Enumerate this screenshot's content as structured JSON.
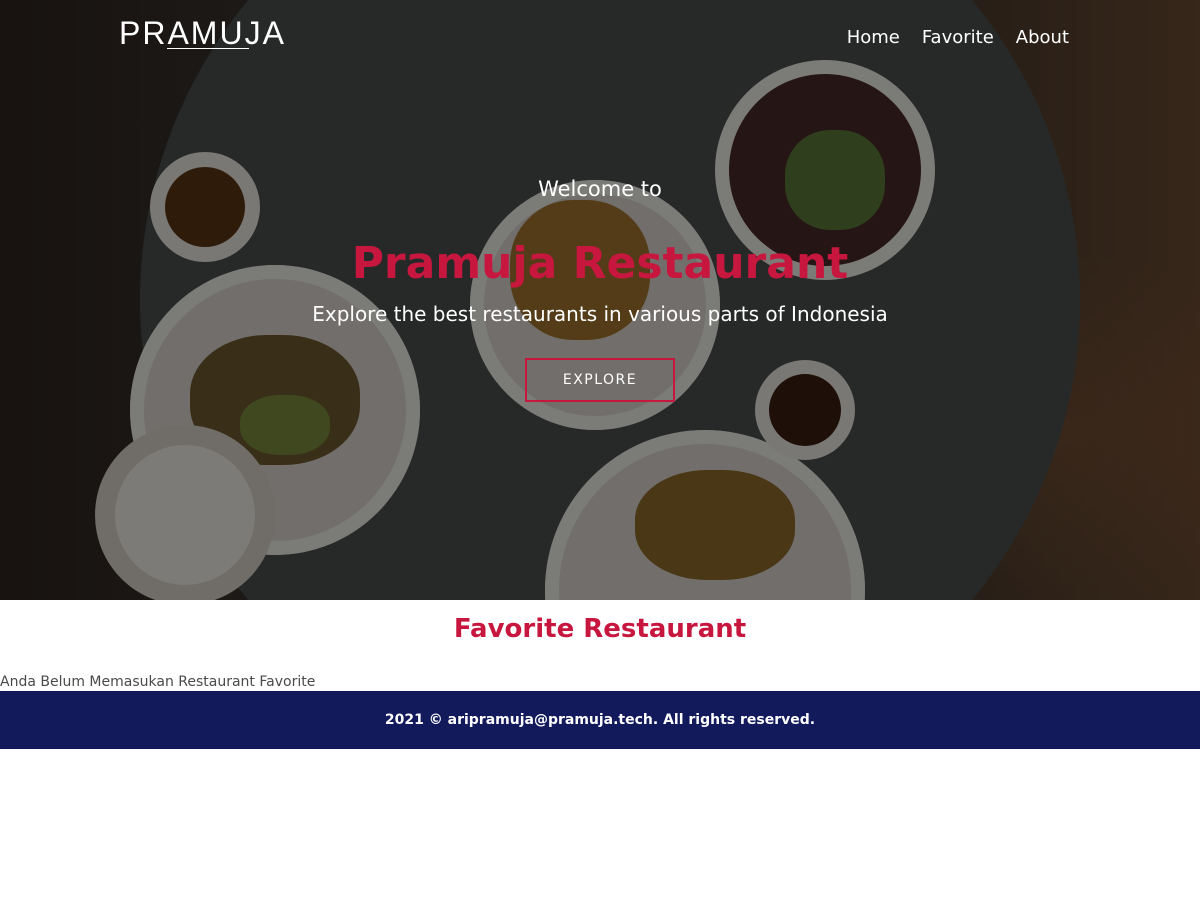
{
  "navbar": {
    "brand": "PRAMUJA",
    "links": [
      {
        "label": "Home"
      },
      {
        "label": "Favorite"
      },
      {
        "label": "About"
      }
    ]
  },
  "hero": {
    "welcome": "Welcome to",
    "title": "Pramuja Restaurant",
    "subtitle": "Explore the best restaurants in various parts of Indonesia",
    "cta_label": "EXPLORE"
  },
  "favorites": {
    "title": "Favorite Restaurant",
    "empty_message": "Anda Belum Memasukan Restaurant Favorite"
  },
  "footer": {
    "text": "2021 © aripramuja@pramuja.tech. All rights reserved."
  },
  "colors": {
    "accent": "#c8173f",
    "footer_bg": "#121a5c",
    "hero_overlay": "rgba(0,0,0,0.48)"
  }
}
